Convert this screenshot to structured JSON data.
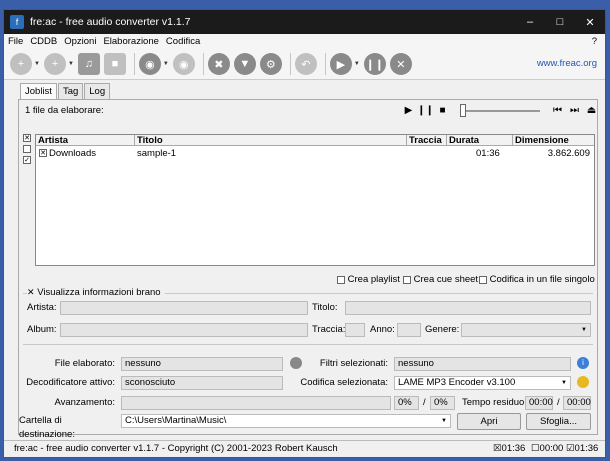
{
  "window": {
    "title": "fre:ac - free audio converter v1.1.7",
    "icon_label": "f"
  },
  "menu": {
    "items": [
      "File",
      "CDDB",
      "Opzioni",
      "Elaborazione",
      "Codifica"
    ],
    "help": "?"
  },
  "toolbar": {
    "link": "www.freac.org"
  },
  "tabs": [
    "Joblist",
    "Tag",
    "Log"
  ],
  "joblist": {
    "count_label": "1 file da elaborare:",
    "columns": [
      "Artista",
      "Titolo",
      "Traccia",
      "Durata",
      "Dimensione"
    ],
    "rows": [
      {
        "artist": "Downloads",
        "title": "sample-1",
        "track": "",
        "duration": "01:36",
        "size": "3.862.609",
        "checked": true
      }
    ]
  },
  "options": {
    "playlist": "Crea playlist",
    "cue": "Crea cue sheet",
    "single": "Codifica in un file singolo"
  },
  "info": {
    "toggle_label": "Visualizza informazioni brano",
    "artist": "Artista:",
    "title": "Titolo:",
    "album": "Album:",
    "track": "Traccia:",
    "year": "Anno:",
    "genre": "Genere:"
  },
  "status": {
    "file_label": "File elaborato:",
    "file_value": "nessuno",
    "filters_label": "Filtri selezionati:",
    "filters_value": "nessuno",
    "decoder_label": "Decodificatore attivo:",
    "decoder_value": "sconosciuto",
    "encoder_label": "Codifica selezionata:",
    "encoder_value": "LAME MP3 Encoder v3.100",
    "progress_label": "Avanzamento:",
    "progress_a": "0%",
    "slash": "/",
    "progress_b": "0%",
    "remaining_label": "Tempo residuo:",
    "remaining_a": "00:00",
    "remaining_b": "00:00",
    "dest_label": "Cartella di destinazione:",
    "dest_value": "C:\\Users\\Martina\\Music\\",
    "open_btn": "Apri",
    "browse_btn": "Sfoglia..."
  },
  "statusbar": {
    "text": "fre:ac - free audio converter v1.1.7 - Copyright (C) 2001-2023 Robert Kausch",
    "t1": "01:36",
    "t2": "00:00",
    "t3": "01:36"
  }
}
